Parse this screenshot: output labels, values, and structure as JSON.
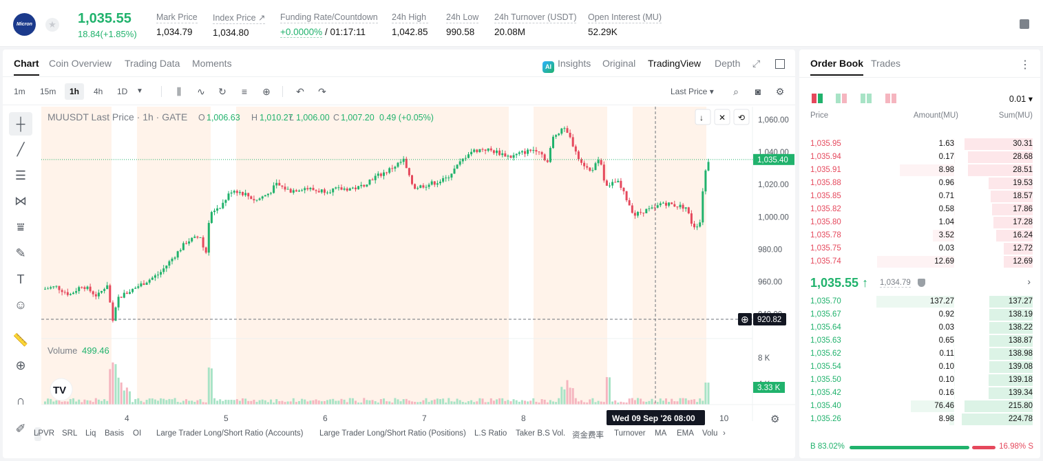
{
  "header": {
    "logo_text": "Micron",
    "last_price": "1,035.55",
    "change": "18.84(+1.85%)",
    "stats": [
      {
        "label": "Mark Price",
        "value": "1,034.79"
      },
      {
        "label": "Index Price ↗",
        "value": "1,034.80"
      },
      {
        "label": "Funding Rate/Countdown",
        "value_green": "+0.0000%",
        "value": " / 01:17:11"
      },
      {
        "label": "24h High",
        "value": "1,042.85"
      },
      {
        "label": "24h Low",
        "value": "990.58"
      },
      {
        "label": "24h Turnover (USDT)",
        "value": "20.08M"
      },
      {
        "label": "Open Interest (MU)",
        "value": "52.29K"
      }
    ]
  },
  "chart_tabs": {
    "left": [
      "Chart",
      "Coin Overview",
      "Trading Data",
      "Moments"
    ],
    "right": [
      "Insights",
      "Original",
      "TradingView",
      "Depth"
    ],
    "ai_badge": "AI"
  },
  "toolbar": {
    "timeframes": [
      "1m",
      "15m",
      "1h",
      "4h",
      "1D"
    ],
    "price_source": "Last Price ▾"
  },
  "legend": {
    "symbol": "MUUSDT Last Price · 1h · GATE",
    "o_label": "O",
    "o": "1,006.63",
    "h_label": "H",
    "h": "1,010.27",
    "l_label": "L",
    "l": "1,006.00",
    "c_label": "C",
    "c": "1,007.20",
    "chg": "0.49 (+0.05%)",
    "volume_label": "Volume",
    "volume_value": "499.46"
  },
  "price_axis": {
    "ticks": [
      "1,060.00",
      "1,040.00",
      "1,020.00",
      "1,000.00",
      "980.00",
      "960.00",
      "940.00"
    ],
    "last_price_label": "1,035.40",
    "crosshair_label": "920.82",
    "volume_ticks": [
      "8 K",
      "4 K"
    ],
    "volume_last_label": "3.33 K"
  },
  "time_axis": {
    "ticks": [
      "4",
      "5",
      "6",
      "7",
      "8",
      "10"
    ],
    "crosshair_label": "Wed 09 Sep '26   08:00"
  },
  "indicators": [
    "LPVR",
    "SRL",
    "Liq",
    "Basis",
    "OI",
    "Large Trader Long/Short Ratio (Accounts)",
    "Large Trader Long/Short Ratio (Positions)",
    "L.S Ratio",
    "Taker B.S Vol.",
    "资金费率",
    "Turnover",
    "MA",
    "EMA",
    "Volu"
  ],
  "chart_data": {
    "type": "candlestick",
    "title": "MUUSDT Last Price · 1h · GATE",
    "ylim": [
      925,
      1068
    ],
    "volume_ylim": [
      0,
      10000
    ],
    "x_ticks": [
      "4",
      "5",
      "6",
      "7",
      "8",
      "10"
    ],
    "series": [
      {
        "name": "Volume",
        "values": []
      }
    ]
  },
  "orderbook": {
    "tabs": [
      "Order Book",
      "Trades"
    ],
    "precision": "0.01 ▾",
    "headers": {
      "price": "Price",
      "amount": "Amount(MU)",
      "sum": "Sum(MU)"
    },
    "asks": [
      {
        "price": "1,035.95",
        "amount": "1.63",
        "sum": "30.31",
        "a": 1.63,
        "s": 30.31
      },
      {
        "price": "1,035.94",
        "amount": "0.17",
        "sum": "28.68",
        "a": 0.17,
        "s": 28.68
      },
      {
        "price": "1,035.91",
        "amount": "8.98",
        "sum": "28.51",
        "a": 8.98,
        "s": 28.51
      },
      {
        "price": "1,035.88",
        "amount": "0.96",
        "sum": "19.53",
        "a": 0.96,
        "s": 19.53
      },
      {
        "price": "1,035.85",
        "amount": "0.71",
        "sum": "18.57",
        "a": 0.71,
        "s": 18.57
      },
      {
        "price": "1,035.82",
        "amount": "0.58",
        "sum": "17.86",
        "a": 0.58,
        "s": 17.86
      },
      {
        "price": "1,035.80",
        "amount": "1.04",
        "sum": "17.28",
        "a": 1.04,
        "s": 17.28
      },
      {
        "price": "1,035.78",
        "amount": "3.52",
        "sum": "16.24",
        "a": 3.52,
        "s": 16.24
      },
      {
        "price": "1,035.75",
        "amount": "0.03",
        "sum": "12.72",
        "a": 0.03,
        "s": 12.72
      },
      {
        "price": "1,035.74",
        "amount": "12.69",
        "sum": "12.69",
        "a": 12.69,
        "s": 12.69
      }
    ],
    "mid_price": "1,035.55 ↑",
    "mid_mark": "1,034.79",
    "bids": [
      {
        "price": "1,035.70",
        "amount": "137.27",
        "sum": "137.27",
        "a": 137.27,
        "s": 137.27
      },
      {
        "price": "1,035.67",
        "amount": "0.92",
        "sum": "138.19",
        "a": 0.92,
        "s": 138.19
      },
      {
        "price": "1,035.64",
        "amount": "0.03",
        "sum": "138.22",
        "a": 0.03,
        "s": 138.22
      },
      {
        "price": "1,035.63",
        "amount": "0.65",
        "sum": "138.87",
        "a": 0.65,
        "s": 138.87
      },
      {
        "price": "1,035.62",
        "amount": "0.11",
        "sum": "138.98",
        "a": 0.11,
        "s": 138.98
      },
      {
        "price": "1,035.54",
        "amount": "0.10",
        "sum": "139.08",
        "a": 0.1,
        "s": 139.08
      },
      {
        "price": "1,035.50",
        "amount": "0.10",
        "sum": "139.18",
        "a": 0.1,
        "s": 139.18
      },
      {
        "price": "1,035.42",
        "amount": "0.16",
        "sum": "139.34",
        "a": 0.16,
        "s": 139.34
      },
      {
        "price": "1,035.40",
        "amount": "76.46",
        "sum": "215.80",
        "a": 76.46,
        "s": 215.8
      },
      {
        "price": "1,035.26",
        "amount": "8.98",
        "sum": "224.78",
        "a": 8.98,
        "s": 224.78
      }
    ],
    "buy_ratio": "B 83.02%",
    "sell_ratio": "16.98% S",
    "buy_fraction": 0.8302
  },
  "colors": {
    "up": "#20b26c",
    "down": "#e5485c",
    "session": "#fff3ea"
  }
}
